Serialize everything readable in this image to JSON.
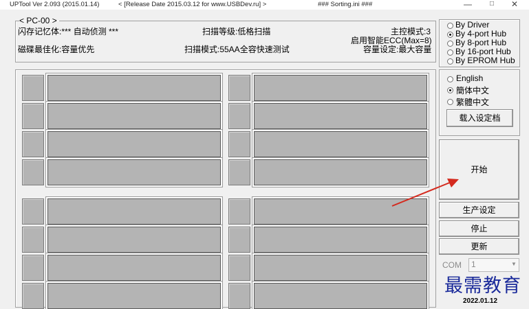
{
  "window": {
    "app_title": "UPTool Ver 2.093 (2015.01.14)",
    "release_info": "< [Release Date 2015.03.12 for www.USBDev.ru] >",
    "ini_file": "### Sorting.ini ###",
    "minimize": "—",
    "maximize": "□",
    "close": "✕"
  },
  "info": {
    "group_title": "< PC-00 >",
    "memory": "闪存记忆体:*** 自动侦测 ***",
    "scan_level": "扫描等级:低格扫描",
    "master_mode": "主控模式:3",
    "ecc": "启用智能ECC(Max=8)",
    "disk_opt": "磁碟最佳化:容量优先",
    "scan_mode": "扫描模式:55AA全容快速测试",
    "capacity": "容量设定:最大容量"
  },
  "hub_options": [
    {
      "label": "By Driver",
      "selected": false
    },
    {
      "label": "By 4-port Hub",
      "selected": true
    },
    {
      "label": "By 8-port Hub",
      "selected": false
    },
    {
      "label": "By 16-port Hub",
      "selected": false
    },
    {
      "label": "By EPROM Hub",
      "selected": false
    }
  ],
  "language_options": [
    {
      "label": "English",
      "selected": false
    },
    {
      "label": "簡体中文",
      "selected": true
    },
    {
      "label": "繁體中文",
      "selected": false
    }
  ],
  "buttons": {
    "load_settings": "载入设定档",
    "start": "开始",
    "production_settings": "生产设定",
    "stop": "停止",
    "update": "更新"
  },
  "com": {
    "label": "COM",
    "value": "1"
  },
  "date_partial": "2022.01.12",
  "watermark": "最需教育"
}
